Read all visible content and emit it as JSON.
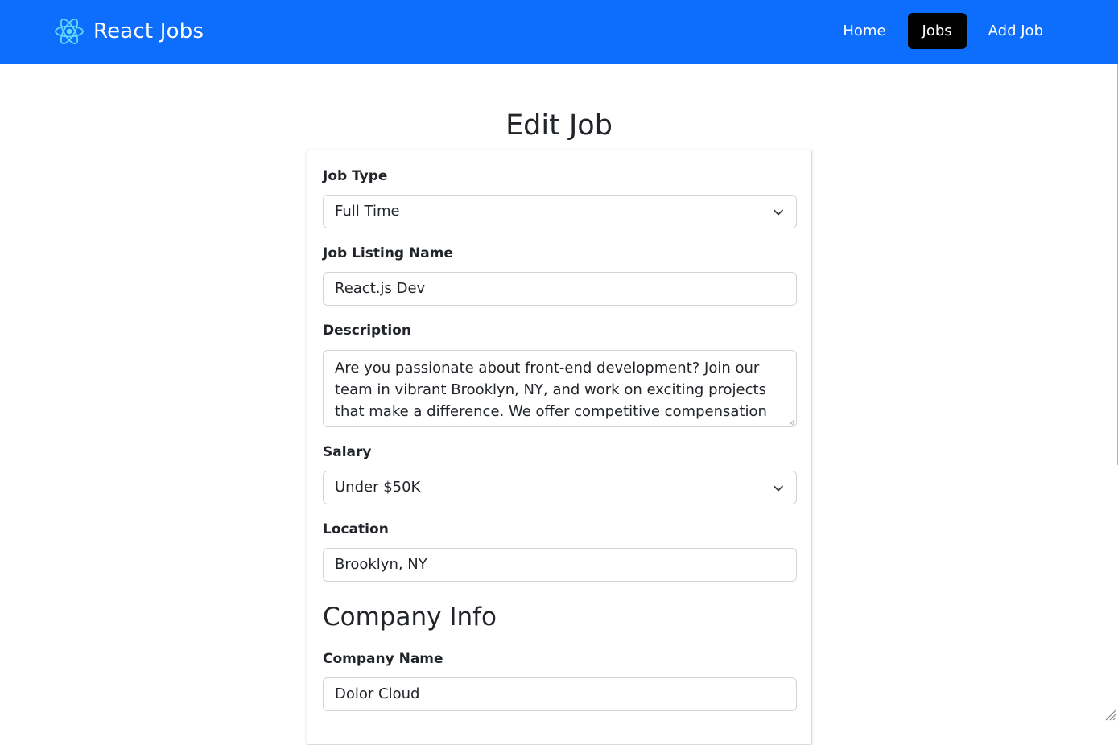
{
  "nav": {
    "brand": "React Jobs",
    "links": [
      {
        "label": "Home",
        "active": false
      },
      {
        "label": "Jobs",
        "active": true
      },
      {
        "label": "Add Job",
        "active": false
      }
    ]
  },
  "colors": {
    "navbar": "#0d6efd",
    "active_link": "#000000",
    "logo": "#61dafb"
  },
  "page": {
    "title": "Edit Job"
  },
  "form": {
    "job_type": {
      "label": "Job Type",
      "value": "Full Time"
    },
    "listing_name": {
      "label": "Job Listing Name",
      "value": "React.js Dev"
    },
    "description": {
      "label": "Description",
      "value": "Are you passionate about front-end development? Join our team in vibrant Brooklyn, NY, and work on exciting projects that make a difference. We offer competitive compensation and a collaborative"
    },
    "salary": {
      "label": "Salary",
      "value": "Under $50K"
    },
    "location": {
      "label": "Location",
      "value": "Brooklyn, NY"
    },
    "company_section": "Company Info",
    "company_name": {
      "label": "Company Name",
      "value": "Dolor Cloud"
    }
  },
  "icons": {
    "logo": "react-logo-icon",
    "select_arrow": "chevron-down-icon",
    "resize": "resize-grip-icon"
  }
}
